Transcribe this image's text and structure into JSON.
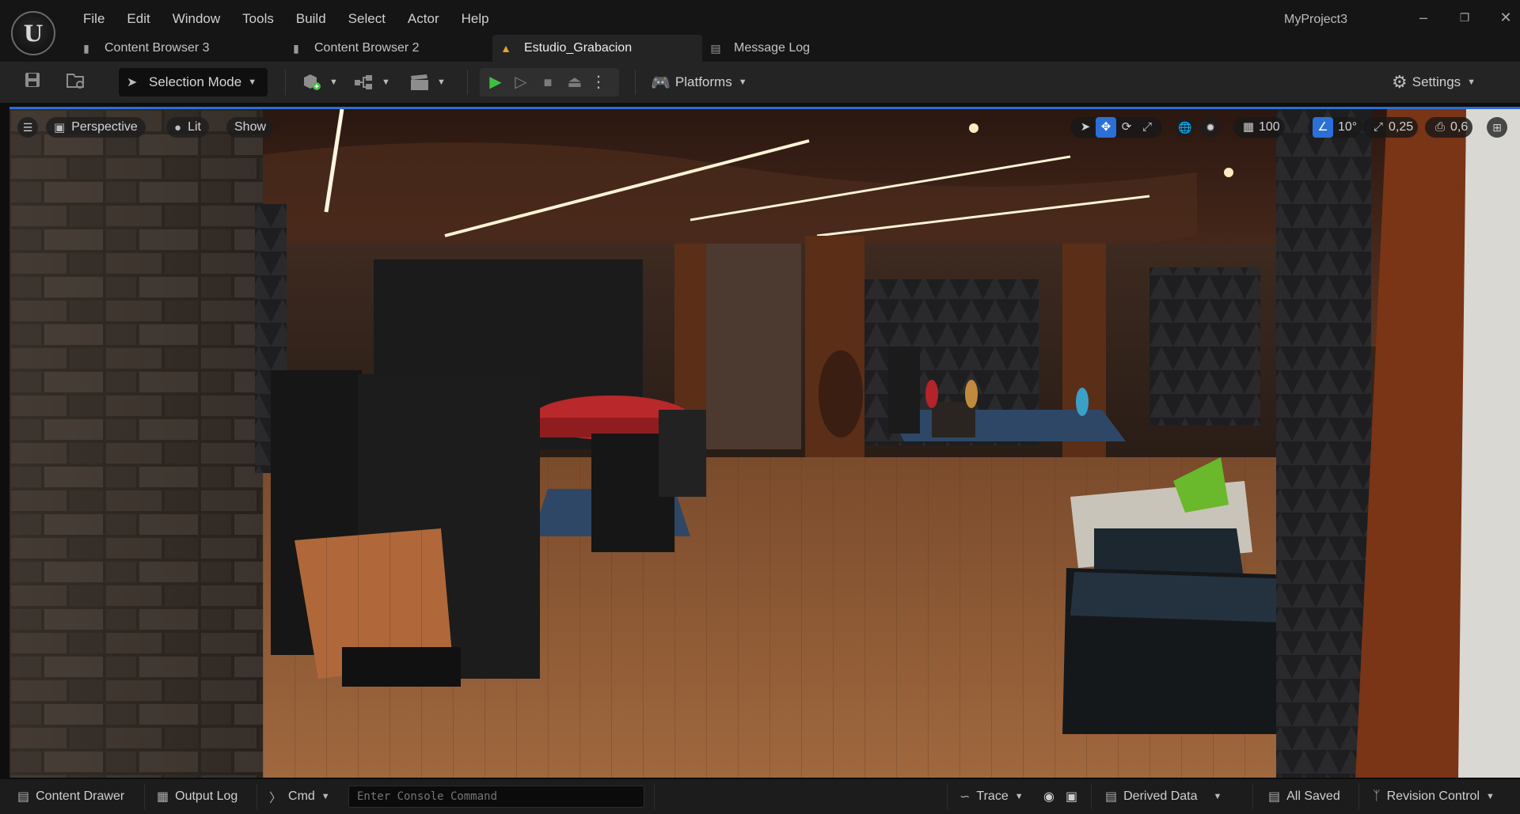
{
  "app": {
    "logo_glyph": "U",
    "project_name": "MyProject3"
  },
  "menu": [
    "File",
    "Edit",
    "Window",
    "Tools",
    "Build",
    "Select",
    "Actor",
    "Help"
  ],
  "tabs": [
    {
      "label": "Content Browser 3",
      "icon": "content-browser-icon"
    },
    {
      "label": "Content Browser 2",
      "icon": "content-browser-icon"
    },
    {
      "label": "Estudio_Grabacion",
      "icon": "level-icon",
      "active": true
    },
    {
      "label": "Message Log",
      "icon": "message-log-icon"
    }
  ],
  "toolbar": {
    "selection_mode": "Selection Mode",
    "platforms": "Platforms",
    "settings": "Settings"
  },
  "viewport": {
    "perspective": "Perspective",
    "lit": "Lit",
    "show": "Show",
    "grid_size": "100",
    "rotation_snap": "10°",
    "scale_snap": "0,25",
    "camera_speed": "0,6",
    "level_name": "Estudio_Grabacion"
  },
  "statusbar": {
    "content_drawer": "Content Drawer",
    "output_log": "Output Log",
    "cmd": "Cmd",
    "console_placeholder": "Enter Console Command",
    "trace": "Trace",
    "derived_data": "Derived Data",
    "all_saved": "All Saved",
    "revision_control": "Revision Control"
  },
  "colors": {
    "accent_blue": "#2c6fd6",
    "play_green": "#3fbf3f",
    "level_tab_orange": "#e8a432"
  }
}
